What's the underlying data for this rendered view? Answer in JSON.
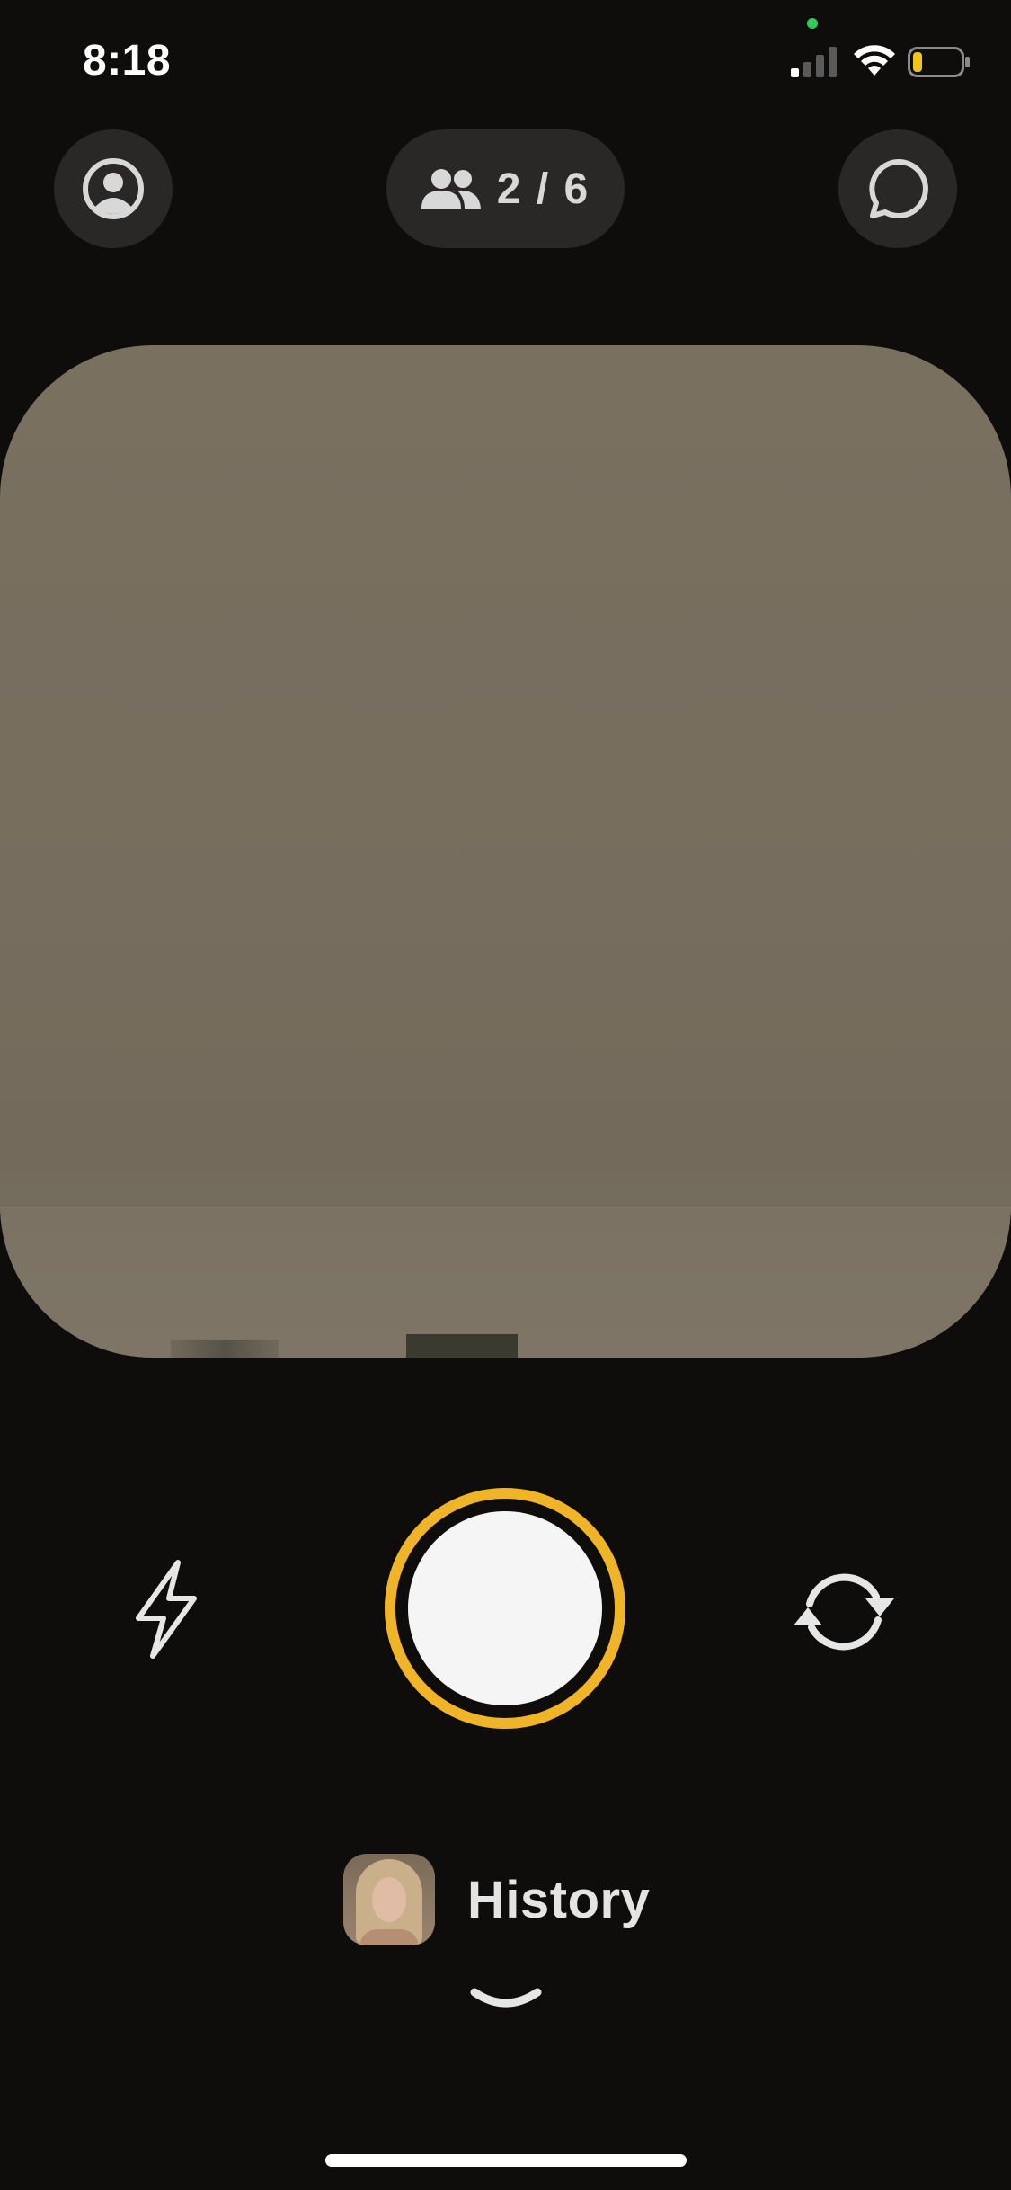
{
  "status_bar": {
    "time": "8:18",
    "icons": [
      "signal-icon",
      "wifi-icon",
      "battery-icon"
    ],
    "battery_level": 0.2,
    "battery_color": "#f0c419"
  },
  "top_bar": {
    "profile_icon": "person-circle-icon",
    "friends_icon": "people-icon",
    "friends_count": "2 / 6",
    "messages_icon": "chat-bubble-icon"
  },
  "controls": {
    "flash_icon": "lightning-icon",
    "shutter_accent": "#f0b429",
    "flip_icon": "rotate-camera-icon"
  },
  "history": {
    "label": "History",
    "expand_icon": "chevron-down-icon"
  }
}
